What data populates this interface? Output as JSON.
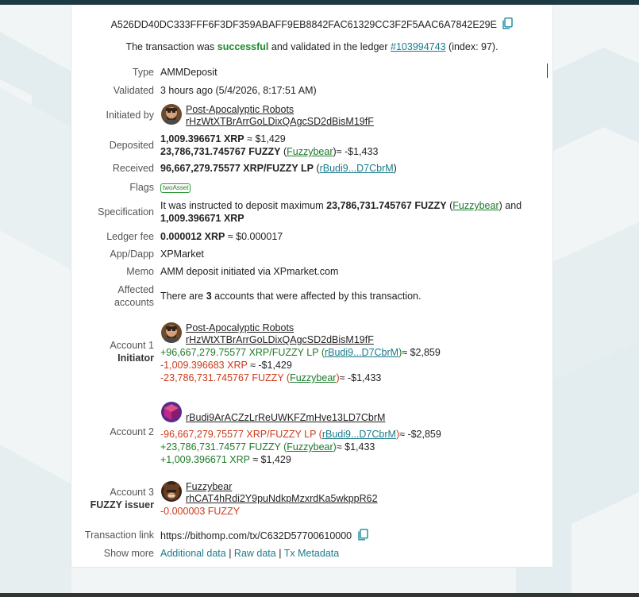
{
  "tx": {
    "hash": "A526DD40DC333FFF6F3DF359ABAFF9EB8842FAC61329CC3F2F5AAC6A7842E29E",
    "status_prefix": "The transaction was",
    "status_word": "successful",
    "status_mid": "and validated in the ledger",
    "ledger_link": "#103994743",
    "status_suffix": "(index: 97)."
  },
  "fields": {
    "type_label": "Type",
    "type_value": "AMMDeposit",
    "validated_label": "Validated",
    "validated_value": "3 hours ago (5/4/2026, 8:17:51 AM)",
    "initiated_label": "Initiated by",
    "initiator_name": "Post-Apocalyptic Robots",
    "initiator_address": "rHzWtXTBrArrGoLDixQAgcSD2dBisM19fF",
    "deposited_label": "Deposited",
    "deposited_xrp": "1,009.396671 XRP",
    "deposited_xrp_usd": "≈ $1,429",
    "deposited_fuzzy": "23,786,731.745767 FUZZY",
    "deposited_fuzzy_issuer": "Fuzzybear",
    "deposited_fuzzy_usd": "≈ -$1,433",
    "received_label": "Received",
    "received_value": "96,667,279.75577 XRP/FUZZY LP",
    "received_link": "rBudi9...D7CbrM",
    "flags_label": "Flags",
    "flag_value": "twoAsset",
    "spec_label": "Specification",
    "spec_text1": "It was instructed to deposit maximum",
    "spec_amount1": "23,786,731.745767 FUZZY",
    "spec_issuer": "Fuzzybear",
    "spec_and": "and",
    "spec_amount2": "1,009.396671 XRP",
    "fee_label": "Ledger fee",
    "fee_value": "0.000012 XRP",
    "fee_usd": "≈ $0.000017",
    "app_label": "App/Dapp",
    "app_value": "XPMarket",
    "memo_label": "Memo",
    "memo_value": "AMM deposit initiated via XPmarket.com",
    "affected_label1": "Affected",
    "affected_label2": "accounts",
    "affected_prefix": "There are",
    "affected_count": "3",
    "affected_suffix": "accounts that were affected by this transaction."
  },
  "accounts": [
    {
      "label": "Account 1",
      "role": "Initiator",
      "name": "Post-Apocalyptic Robots",
      "address": "rHzWtXTBrArrGoLDixQAgcSD2dBisM19fF",
      "line1_amount": "+96,667,279.75577 XRP/FUZZY LP",
      "line1_link": "rBudi9...D7CbrM",
      "line1_usd": "≈ $2,859",
      "line2_amount": "-1,009.396683 XRP",
      "line2_usd": "≈ -$1,429",
      "line3_amount": "-23,786,731.745767 FUZZY",
      "line3_issuer": "Fuzzybear",
      "line3_usd": "≈ -$1,433"
    },
    {
      "label": "Account 2",
      "address": "rBudi9ArACZzLrReUWKFZmHve13LD7CbrM",
      "line1_amount": "-96,667,279.75577 XRP/FUZZY LP",
      "line1_link": "rBudi9...D7CbrM",
      "line1_usd": "≈ -$2,859",
      "line2_amount": "+23,786,731.74577 FUZZY",
      "line2_issuer": "Fuzzybear",
      "line2_usd": "≈ $1,433",
      "line3_amount": "+1,009.396671 XRP",
      "line3_usd": "≈ $1,429"
    },
    {
      "label": "Account 3",
      "role": "FUZZY issuer",
      "name": "Fuzzybear",
      "address": "rhCAT4hRdi2Y9puNdkpMzxrdKa5wkppR62",
      "line1_amount": "-0.000003 FUZZY"
    }
  ],
  "footer": {
    "link_label": "Transaction link",
    "link_value": "https://bithomp.com/tx/C632D57700610000",
    "more_label": "Show more",
    "more_1": "Additional data",
    "more_2": "Raw data",
    "more_3": "Tx Metadata",
    "sep": "|"
  },
  "colors": {
    "success": "#1a8a2a",
    "positive": "#1f7a2a",
    "negative": "#cc3a1a",
    "link": "#1a7a8a"
  },
  "icons": [
    "copy-icon",
    "avatar-robot",
    "avatar-cube",
    "avatar-bear"
  ]
}
